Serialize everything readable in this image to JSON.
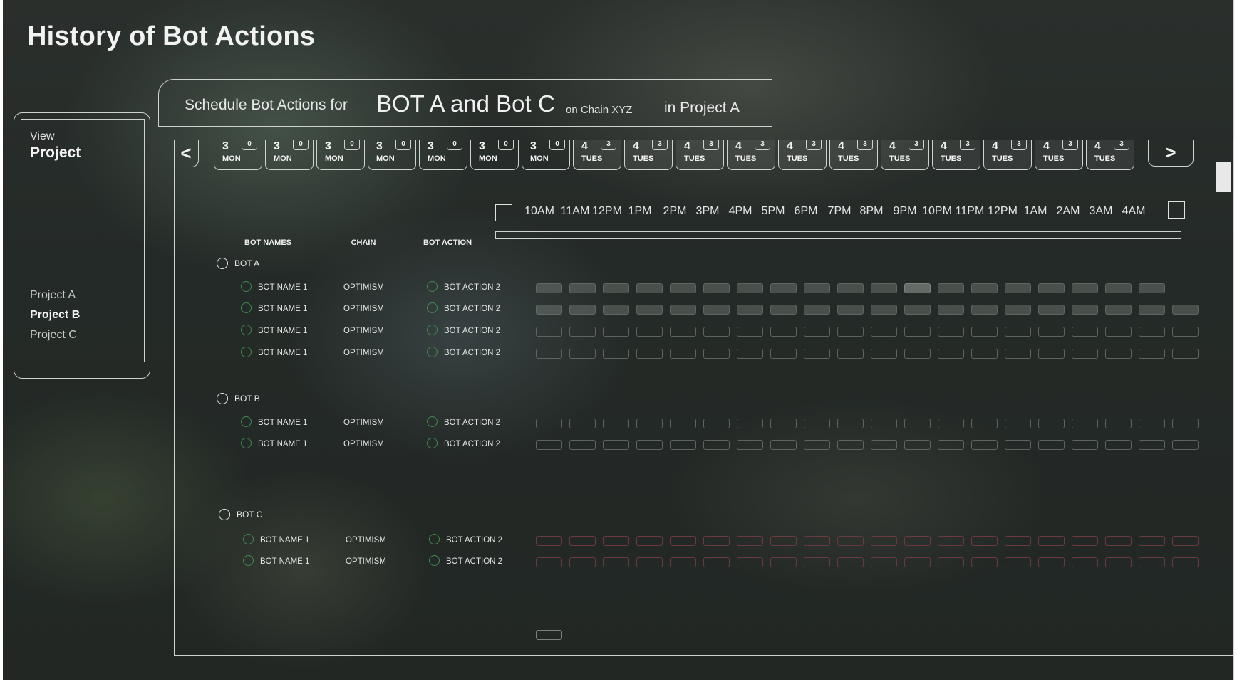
{
  "page": {
    "title": "History of Bot Actions"
  },
  "sidebar": {
    "view_label": "View",
    "heading": "Project",
    "projects": [
      {
        "label": "Project A",
        "active": false
      },
      {
        "label": "Project B",
        "active": true
      },
      {
        "label": "Project C",
        "active": false
      }
    ]
  },
  "schedule_header": {
    "prefix": "Schedule Bot Actions for",
    "bots": "BOT A and Bot C",
    "chain": "on Chain XYZ",
    "project": "in Project A"
  },
  "navigation": {
    "prev_label": "<",
    "next_label": ">"
  },
  "days": [
    {
      "num": "3",
      "name": "MON",
      "badge": "0"
    },
    {
      "num": "3",
      "name": "MON",
      "badge": "0"
    },
    {
      "num": "3",
      "name": "MON",
      "badge": "0"
    },
    {
      "num": "3",
      "name": "MON",
      "badge": "0"
    },
    {
      "num": "3",
      "name": "MON",
      "badge": "0"
    },
    {
      "num": "3",
      "name": "MON",
      "badge": "0"
    },
    {
      "num": "3",
      "name": "MON",
      "badge": "0"
    },
    {
      "num": "4",
      "name": "TUES",
      "badge": "3"
    },
    {
      "num": "4",
      "name": "TUES",
      "badge": "3"
    },
    {
      "num": "4",
      "name": "TUES",
      "badge": "3"
    },
    {
      "num": "4",
      "name": "TUES",
      "badge": "3"
    },
    {
      "num": "4",
      "name": "TUES",
      "badge": "3"
    },
    {
      "num": "4",
      "name": "TUES",
      "badge": "3"
    },
    {
      "num": "4",
      "name": "TUES",
      "badge": "3"
    },
    {
      "num": "4",
      "name": "TUES",
      "badge": "3"
    },
    {
      "num": "4",
      "name": "TUES",
      "badge": "3"
    },
    {
      "num": "4",
      "name": "TUES",
      "badge": "3"
    },
    {
      "num": "4",
      "name": "TUES",
      "badge": "3"
    }
  ],
  "times": [
    "10AM",
    "11AM",
    "12PM",
    "1PM",
    "2PM",
    "3PM",
    "4PM",
    "5PM",
    "6PM",
    "7PM",
    "8PM",
    "9PM",
    "10PM",
    "11PM",
    "12PM",
    "1AM",
    "2AM",
    "3AM",
    "4AM"
  ],
  "columns": {
    "bot_names": "BOT NAMES",
    "chain": "CHAIN",
    "bot_action": "BOT ACTION"
  },
  "groups": [
    {
      "label": "BOT A",
      "rows": [
        {
          "name": "BOT NAME 1",
          "chain": "OPTIMISM",
          "action": "BOT ACTION 2",
          "style": "filled"
        },
        {
          "name": "BOT NAME 1",
          "chain": "OPTIMISM",
          "action": "BOT ACTION 2",
          "style": "filled"
        },
        {
          "name": "BOT NAME 1",
          "chain": "OPTIMISM",
          "action": "BOT ACTION 2",
          "style": "outline"
        },
        {
          "name": "BOT NAME 1",
          "chain": "OPTIMISM",
          "action": "BOT ACTION 2",
          "style": "outline"
        }
      ]
    },
    {
      "label": "BOT B",
      "rows": [
        {
          "name": "BOT NAME 1",
          "chain": "OPTIMISM",
          "action": "BOT ACTION 2",
          "style": "outline"
        },
        {
          "name": "BOT NAME 1",
          "chain": "OPTIMISM",
          "action": "BOT ACTION 2",
          "style": "outline"
        }
      ]
    },
    {
      "label": "BOT C",
      "rows": [
        {
          "name": "BOT NAME 1",
          "chain": "OPTIMISM",
          "action": "BOT ACTION 2",
          "style": "red"
        },
        {
          "name": "BOT NAME 1",
          "chain": "OPTIMISM",
          "action": "BOT ACTION 2",
          "style": "red"
        }
      ]
    }
  ],
  "colors": {
    "outline": "#cfd3cf",
    "row_radio": "#3f8a4e",
    "red_slot": "#6a3a40"
  }
}
